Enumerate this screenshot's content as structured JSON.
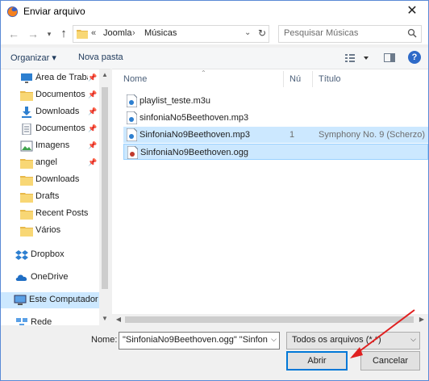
{
  "window": {
    "title": "Enviar arquivo",
    "close": "✕"
  },
  "address": {
    "chevron": "«",
    "crumbs": [
      "Joomla",
      "Músicas"
    ],
    "separator": "›",
    "search_placeholder": "Pesquisar Músicas"
  },
  "toolbar": {
    "organize_label": "Organizar ▾",
    "new_folder_label": "Nova pasta"
  },
  "nav": {
    "items": [
      {
        "label": "Área de Traba",
        "icon": "desktop-icon",
        "pinned": true
      },
      {
        "label": "Documentos",
        "icon": "star-folder-icon",
        "pinned": true
      },
      {
        "label": "Downloads",
        "icon": "download-icon",
        "pinned": true
      },
      {
        "label": "Documentos",
        "icon": "document-icon",
        "pinned": true
      },
      {
        "label": "Imagens",
        "icon": "images-icon",
        "pinned": true
      },
      {
        "label": "angel",
        "icon": "folder-icon",
        "pinned": true
      },
      {
        "label": "Downloads",
        "icon": "folder-icon",
        "pinned": false
      },
      {
        "label": "Drafts",
        "icon": "folder-icon",
        "pinned": false
      },
      {
        "label": "Recent Posts",
        "icon": "folder-icon",
        "pinned": false
      },
      {
        "label": "Vários",
        "icon": "folder-icon",
        "pinned": false
      },
      {
        "label": "Dropbox",
        "icon": "dropbox-icon",
        "pinned": false
      },
      {
        "label": "OneDrive",
        "icon": "cloud-icon",
        "pinned": false
      },
      {
        "label": "Este Computador",
        "icon": "computer-icon",
        "pinned": false
      },
      {
        "label": "Rede",
        "icon": "network-icon",
        "pinned": false
      }
    ]
  },
  "columns": {
    "name": "Nome",
    "num": "Nú",
    "title": "Título"
  },
  "files": [
    {
      "name": "playlist_teste.m3u",
      "num": "",
      "title": "",
      "icon": "playlist-file-icon"
    },
    {
      "name": "sinfoniaNo5Beethoven.mp3",
      "num": "",
      "title": "",
      "icon": "audio-file-icon"
    },
    {
      "name": "SinfoniaNo9Beethoven.mp3",
      "num": "1",
      "title": "Symphony No. 9 (Scherzo)",
      "icon": "audio-file-icon"
    },
    {
      "name": "SinfoniaNo9Beethoven.ogg",
      "num": "",
      "title": "",
      "icon": "ogg-file-icon"
    }
  ],
  "footer": {
    "name_label": "Nome:",
    "name_value": "\"SinfoniaNo9Beethoven.ogg\" \"Sinfon",
    "file_type": "Todos os arquivos (*.*)",
    "open_label": "Abrir",
    "cancel_label": "Cancelar"
  },
  "colors": {
    "selection": "#cce8ff",
    "accent": "#0078d7",
    "annotation_arrow": "#e02020"
  }
}
